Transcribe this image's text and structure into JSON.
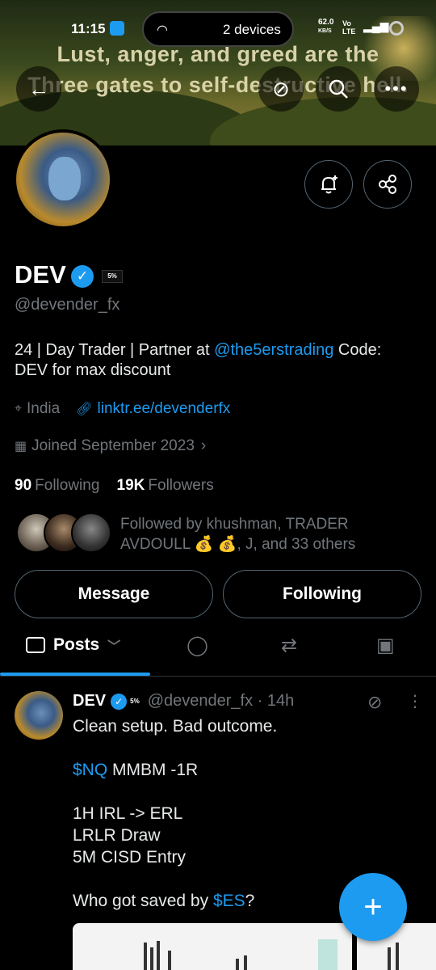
{
  "status_bar": {
    "time": "11:15",
    "devices": "2 devices",
    "net_speed": "62.0",
    "net_unit": "KB/S",
    "network": "Vo LTE",
    "signal": "4G"
  },
  "banner": {
    "quote_line1": "Lust, anger, and greed are the",
    "quote_line2": "Three gates to self-destructive hell."
  },
  "profile": {
    "name": "DEV",
    "affiliate_badge": "5%",
    "handle": "@devender_fx",
    "bio_prefix": "24 | Day Trader | Partner at ",
    "bio_mention": "@the5erstrading",
    "bio_suffix": " Code: DEV for max discount",
    "location": "India",
    "website": "linktr.ee/devenderfx",
    "joined": "Joined September 2023",
    "following_count": "90",
    "following_label": "Following",
    "followers_count": "19K",
    "followers_label": "Followers",
    "followed_by": "Followed by khushman, TRADER AVDOULL 💰 💰, J, and 33 others"
  },
  "buttons": {
    "message": "Message",
    "following": "Following"
  },
  "tabs": {
    "posts": "Posts"
  },
  "post": {
    "name": "DEV",
    "affiliate_badge": "5%",
    "handle_time": "@devender_fx · 14h",
    "line1": "Clean setup. Bad outcome.",
    "cashtag1": "$NQ",
    "line2_rest": " MMBM -1R",
    "line3": "1H IRL -> ERL",
    "line4": "LRLR Draw",
    "line5": "5M CISD Entry",
    "line6_prefix": "Who got saved by ",
    "cashtag2": "$ES",
    "line6_suffix": "?"
  },
  "fab": {
    "label": "+"
  },
  "colors": {
    "accent": "#1d9bf0",
    "muted": "#71767b",
    "background": "#000000"
  },
  "icons": [
    "back-arrow-icon",
    "grok-icon",
    "search-icon",
    "more-icon",
    "bell-plus-icon",
    "share-icon",
    "location-icon",
    "link-icon",
    "calendar-icon",
    "posts-icon",
    "replies-icon",
    "reposts-icon",
    "media-icon",
    "plus-icon"
  ]
}
